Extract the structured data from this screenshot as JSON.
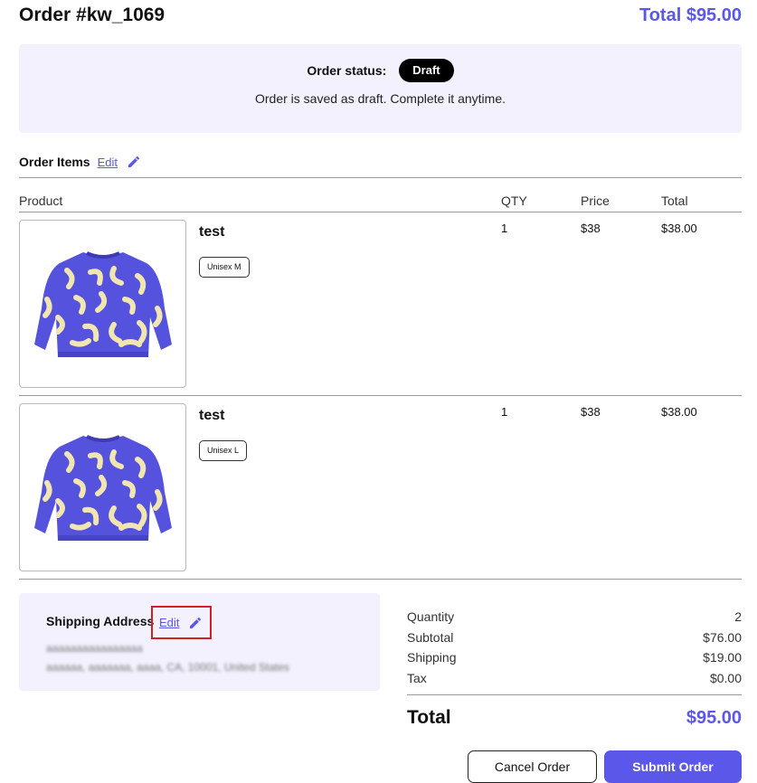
{
  "header": {
    "order_title": "Order #kw_1069",
    "total_text": "Total $95.00"
  },
  "status": {
    "label": "Order status:",
    "badge": "Draft",
    "message": "Order is saved as draft. Complete it anytime."
  },
  "order_items": {
    "title": "Order Items",
    "edit_label": "Edit",
    "columns": {
      "product": "Product",
      "qty": "QTY",
      "price": "Price",
      "total": "Total"
    },
    "items": [
      {
        "name": "test",
        "variant": "Unisex M",
        "qty": "1",
        "price": "$38",
        "total": "$38.00"
      },
      {
        "name": "test",
        "variant": "Unisex L",
        "qty": "1",
        "price": "$38",
        "total": "$38.00"
      }
    ]
  },
  "shipping": {
    "title": "Shipping Address",
    "edit_label": "Edit",
    "name_blurred": "aaaaaaaaaaaaaaaa",
    "address_blurred": "aaaaaa, aaaaaaa, aaaa, CA, 10001, United States"
  },
  "summary": {
    "rows": [
      {
        "label": "Quantity",
        "value": "2"
      },
      {
        "label": "Subtotal",
        "value": "$76.00"
      },
      {
        "label": "Shipping",
        "value": "$19.00"
      },
      {
        "label": "Tax",
        "value": "$0.00"
      }
    ],
    "total_label": "Total",
    "total_value": "$95.00"
  },
  "actions": {
    "cancel_label": "Cancel Order",
    "submit_label": "Submit Order"
  },
  "colors": {
    "accent": "#5b57e8",
    "panel_bg": "#f2f1fd",
    "sweater_body": "#5552dd",
    "sweater_pattern": "#f2e6b0",
    "highlight_box": "#d21f1f"
  },
  "icons": {
    "edit": "pencil-icon",
    "product_image": "sweater-image"
  }
}
